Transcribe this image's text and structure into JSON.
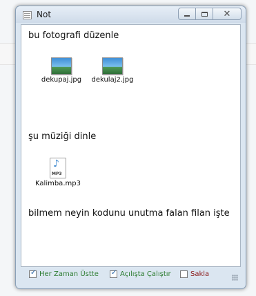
{
  "window": {
    "title": "Not"
  },
  "note": {
    "line1": "bu fotografi düzenle",
    "line2": "şu müziği dinle",
    "line3": "bilmem neyin kodunu unutma falan filan işte"
  },
  "files": [
    {
      "name": "dekupaj.jpg",
      "icon": "image-file-icon"
    },
    {
      "name": "dekulaj2.jpg",
      "icon": "image-file-icon"
    },
    {
      "name": "Kalimba.mp3",
      "icon": "mp3-file-icon"
    }
  ],
  "footer": {
    "always_on_top": {
      "label": "Her Zaman Üstte",
      "checked": true,
      "color": "#2e7d32"
    },
    "run_at_startup": {
      "label": "Açılışta Çalıştır",
      "checked": true,
      "color": "#2e7d32"
    },
    "hide": {
      "label": "Sakla",
      "checked": false,
      "color": "#8b1a1a"
    }
  }
}
